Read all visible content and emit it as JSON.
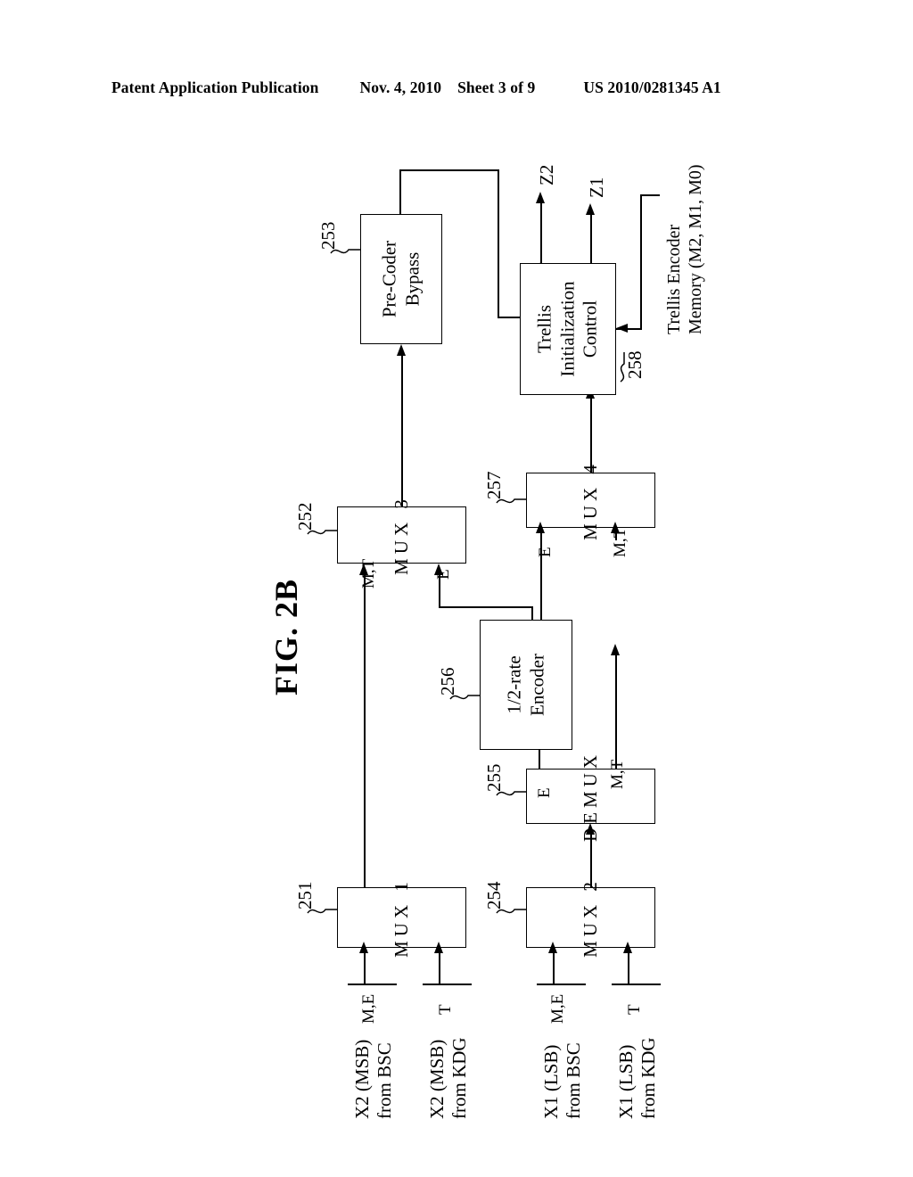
{
  "header": {
    "publication": "Patent Application Publication",
    "date": "Nov. 4, 2010",
    "sheet": "Sheet 3 of 9",
    "docnum": "US 2010/0281345 A1"
  },
  "figure": {
    "title": "FIG. 2B",
    "blocks": [
      {
        "id": "mux1",
        "ref": "251",
        "label": "MUX 1"
      },
      {
        "id": "mux3",
        "ref": "252",
        "label": "MUX 3"
      },
      {
        "id": "precoder",
        "ref": "253",
        "label_line1": "Pre-Coder",
        "label_line2": "Bypass"
      },
      {
        "id": "mux2",
        "ref": "254",
        "label": "MUX 2"
      },
      {
        "id": "demux",
        "ref": "255",
        "label": "DEMUX"
      },
      {
        "id": "encoder",
        "ref": "256",
        "label_line1": "1/2-rate",
        "label_line2": "Encoder"
      },
      {
        "id": "mux4",
        "ref": "257",
        "label": "MUX 4"
      },
      {
        "id": "trellis",
        "ref": "258",
        "label_line1": "Trellis",
        "label_line2": "Initialization",
        "label_line3": "Control"
      }
    ],
    "inputs": [
      {
        "id": "x2-bsc",
        "signal": "M,E",
        "line1": "X2 (MSB)",
        "line2": "from BSC"
      },
      {
        "id": "x2-kdg",
        "signal": "T",
        "line1": "X2 (MSB)",
        "line2": "from KDG"
      },
      {
        "id": "x1-bsc",
        "signal": "M,E",
        "line1": "X1 (LSB)",
        "line2": "from BSC"
      },
      {
        "id": "x1-kdg",
        "signal": "T",
        "line1": "X1 (LSB)",
        "line2": "from KDG"
      }
    ],
    "outputs": [
      {
        "id": "z2",
        "label": "Z2"
      },
      {
        "id": "z1",
        "label": "Z1"
      }
    ],
    "signals": {
      "mux3_mt": "M,T",
      "mux3_e": "E",
      "mux4_e": "E",
      "mux4_mt": "M,T",
      "demux_e": "E",
      "demux_mt": "M,T"
    },
    "memory_label_line1": "Trellis Encoder",
    "memory_label_line2": "Memory (M2, M1, M0)"
  }
}
